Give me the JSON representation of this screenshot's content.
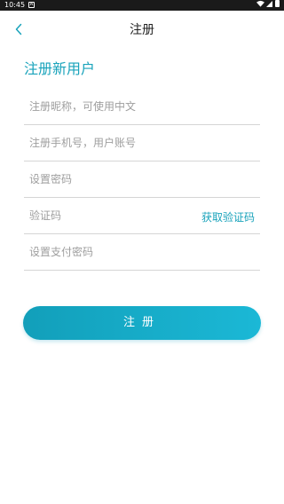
{
  "status_bar": {
    "time": "10:45",
    "notification_icon": "app-notification-icon"
  },
  "nav": {
    "title": "注册",
    "back_icon": "chevron-left-icon"
  },
  "page": {
    "heading": "注册新用户"
  },
  "form": {
    "nickname": {
      "value": "",
      "placeholder": "注册昵称，可使用中文"
    },
    "phone": {
      "value": "",
      "placeholder": "注册手机号，用户账号"
    },
    "password": {
      "value": "",
      "placeholder": "设置密码"
    },
    "code": {
      "value": "",
      "placeholder": "验证码",
      "get_code_label": "获取验证码"
    },
    "pay_password": {
      "value": "",
      "placeholder": "设置支付密码"
    }
  },
  "submit": {
    "label": "注册"
  },
  "colors": {
    "accent": "#19a3bb",
    "button_start": "#129fba",
    "button_end": "#1bb8d6",
    "status_bar": "#1a1a1a"
  }
}
